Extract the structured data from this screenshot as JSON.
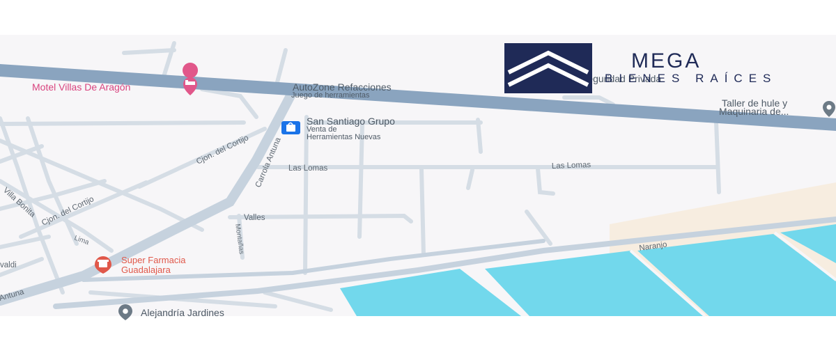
{
  "brand": {
    "name": "MEGA",
    "tagline": "BIENES RAÍCES",
    "color": "#1f2a57"
  },
  "map": {
    "colors": {
      "background": "#f7f6f8",
      "minor_road": "#d5dde5",
      "major_road": "#8aa4bf",
      "secondary_road": "#c6d2de",
      "water": "#72d8ec",
      "sand": "#f7ede0"
    },
    "pois": {
      "motel": "Motel Villas De Aragón",
      "autozone": "AutoZone Refacciones",
      "autozone_sub": "Juego de herramientas",
      "santiago": "San Santiago Grupo",
      "santiago_sub1": "Venta de",
      "santiago_sub2": "Herramientas Nuevas",
      "taller1": "Taller de hule y",
      "taller2": "Maquinaria de...",
      "farmacia1": "Super Farmacia",
      "farmacia2": "Guadalajara",
      "alejandria": "Alejandría Jardines",
      "seguridad": "Seguridad Privada"
    },
    "streets": {
      "las_lomas_1": "Las Lomas",
      "las_lomas_2": "Las Lomas",
      "valles": "Valles",
      "naranjo": "Naranjo",
      "carrola": "Carrola Antuna",
      "cortijo_1": "Cjon. del Cortijo",
      "cortijo_2": "Cjon. del Cortijo",
      "villa_bonita": "Villa Bonita",
      "montanas": "Montañas",
      "lima": "Lima",
      "valdi": "valdi",
      "antuna": "Antuna"
    },
    "icons": [
      "hotel-icon",
      "shopping-bag-icon",
      "pharmacy-icon",
      "location-pin-icon"
    ]
  }
}
